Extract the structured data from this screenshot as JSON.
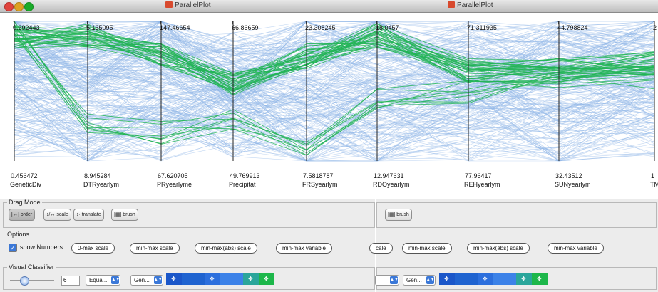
{
  "window_left": {
    "title": "ParallelPlot"
  },
  "window_right": {
    "title": "ParallelPlot"
  },
  "colors": {
    "line_blue": "#8fb6e8",
    "line_green": "#21b455",
    "axis": "#222222"
  },
  "axes": [
    {
      "name": "GeneticDiv",
      "max": "0.692443",
      "min": "0.456472",
      "dir": "↑"
    },
    {
      "name": "DTRyearlym",
      "max": "5.165095",
      "min": "8.945284",
      "dir": "↓"
    },
    {
      "name": "PRyearlyme",
      "max": "147.46654",
      "min": "67.620705",
      "dir": "↑"
    },
    {
      "name": "Precipitat",
      "max": "66.86659",
      "min": "49.769913",
      "dir": "↑"
    },
    {
      "name": "FRSyearlym",
      "max": "23.308245",
      "min": "7.5818787",
      "dir": "↑"
    },
    {
      "name": "RDOyearlym",
      "max": "18.0457",
      "min": "12.947631",
      "dir": "↑"
    },
    {
      "name": "REHyearlym",
      "max": "71.311935",
      "min": "77.96417",
      "dir": "↓"
    },
    {
      "name": "SUNyearlym",
      "max": "44.798824",
      "min": "32.43512",
      "dir": "↑"
    },
    {
      "name": "TMP",
      "max": "2",
      "min": "1",
      "dir": "↑"
    }
  ],
  "left_panel": {
    "drag_mode_label": "Drag Mode",
    "drag_buttons": [
      "[↔] order",
      "↕/↔ scale",
      "↕· translate",
      "|▦| brush"
    ],
    "options_label": "Options",
    "show_numbers": "show Numbers",
    "scale_buttons": [
      "0-max scale",
      "min-max scale",
      "min-max(abs) scale",
      "min-max variable"
    ],
    "visual_classifier_label": "Visual Classifier",
    "class_count": "6",
    "select1": "Equa...",
    "select2": "Gen..."
  },
  "right_panel": {
    "brush_button": "|▦| brush",
    "scale_buttons": [
      "cale",
      "min-max scale",
      "min-max(abs) scale",
      "min-max variable"
    ],
    "select2": "Gen..."
  },
  "swatches_left": [
    "#1a56c9",
    "#1f63d0",
    "#2c6fdd",
    "#3c82e8",
    "#2aa69b",
    "#1db74a"
  ],
  "swatches_right": [
    "#1a56c9",
    "#1f63d0",
    "#2c6fdd",
    "#3c82e8",
    "#2aa69b",
    "#1db74a"
  ]
}
